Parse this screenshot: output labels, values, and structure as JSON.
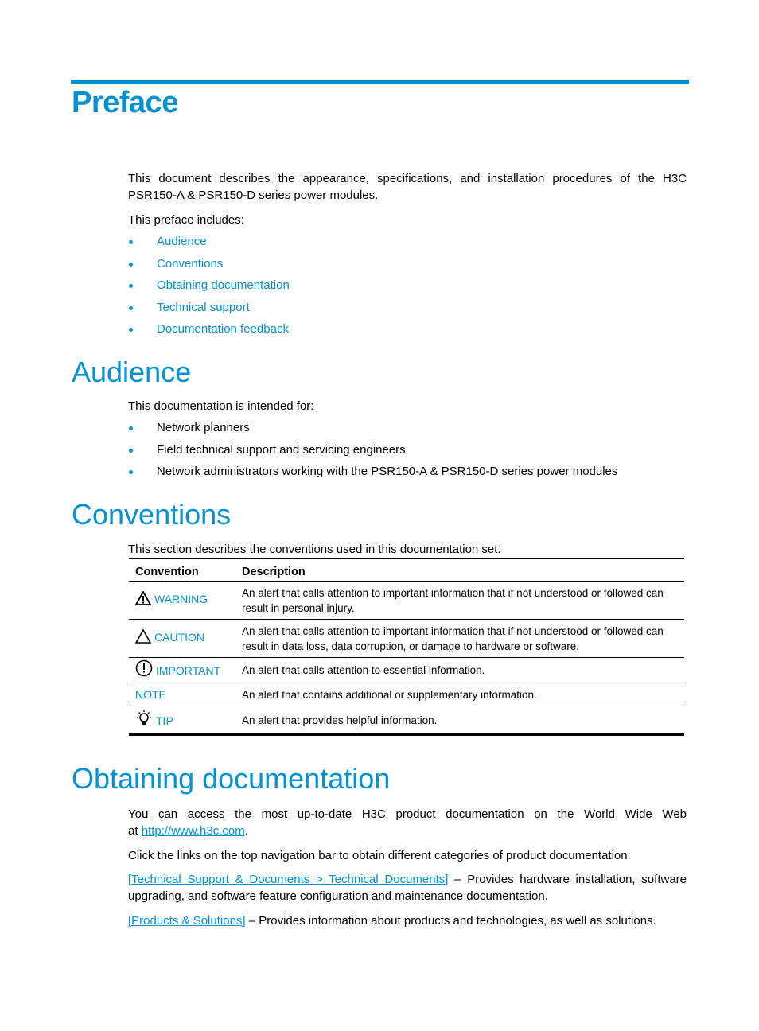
{
  "preface": {
    "title": "Preface",
    "intro_line1": "This document describes the appearance, specifications, and installation procedures of the H3C",
    "intro_line2": "PSR150-A & PSR150-D series power modules.",
    "includes_label": "This preface includes:",
    "toc": [
      {
        "label": "Audience"
      },
      {
        "label": "Conventions"
      },
      {
        "label": "Obtaining documentation"
      },
      {
        "label": "Technical support"
      },
      {
        "label": "Documentation feedback"
      }
    ]
  },
  "audience": {
    "title": "Audience",
    "intro": "This documentation is intended for:",
    "items": [
      {
        "label": "Network planners"
      },
      {
        "label": "Field technical support and servicing engineers"
      },
      {
        "label": "Network administrators working with the PSR150-A & PSR150-D series power modules"
      }
    ]
  },
  "conventions": {
    "title": "Conventions",
    "intro": "This section describes the conventions used in this documentation set.",
    "columns": [
      "Convention",
      "Description"
    ],
    "rows": [
      {
        "icon": "warning-icon",
        "label": "WARNING",
        "description": "An alert that calls attention to important information that if not understood or followed can result in personal injury."
      },
      {
        "icon": "caution-icon",
        "label": "CAUTION",
        "description": "An alert that calls attention to important information that if not understood or followed can result in data loss, data corruption, or damage to hardware or software."
      },
      {
        "icon": "important-icon",
        "label": "IMPORTANT",
        "description": "An alert that calls attention to essential information."
      },
      {
        "icon": "",
        "label": "NOTE",
        "description": "An alert that contains additional or supplementary information."
      },
      {
        "icon": "tip-lightbulb-icon",
        "label": "TIP",
        "description": "An alert that provides helpful information."
      }
    ]
  },
  "obtaining": {
    "title": "Obtaining documentation",
    "p1_line1": "You can access the most up-to-date H3C product documentation on the World Wide Web",
    "p1_prefix": "at ",
    "p1_link": "http://www.h3c.com",
    "p1_suffix": ".",
    "p2": "Click the links on the top navigation bar to obtain different categories of product documentation:",
    "p3_link": "[Technical Support & Documents > Technical Documents]",
    "p3_text": " – Provides hardware installation, software upgrading, and software feature configuration and maintenance documentation.",
    "p4_link": "[Products & Solutions]",
    "p4_text": " – Provides information about products and technologies, as well as solutions."
  },
  "colors": {
    "accent": "#0091d0",
    "text": "#000000"
  }
}
